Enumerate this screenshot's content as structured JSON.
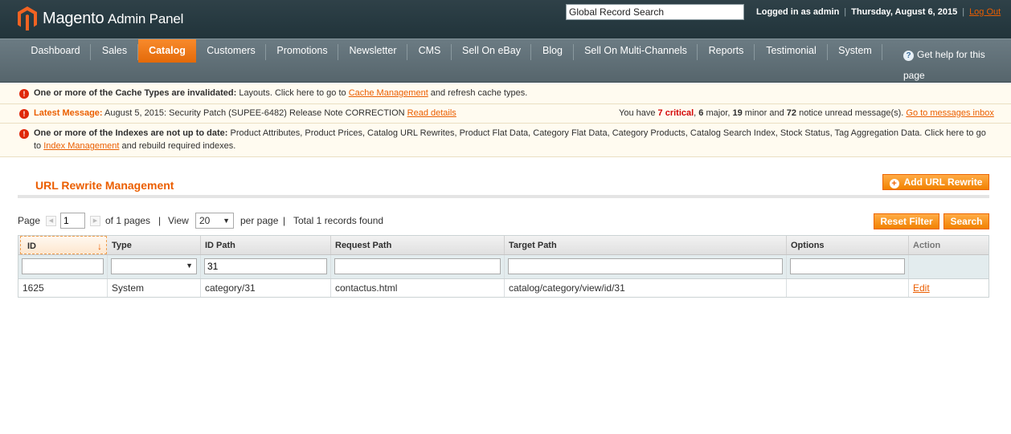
{
  "header": {
    "logo_main": "Magento",
    "logo_sub": "Admin Panel",
    "global_search_placeholder": "Global Record Search",
    "logged_in": "Logged in as admin",
    "date": "Thursday, August 6, 2015",
    "logout": "Log Out"
  },
  "nav": {
    "items": [
      "Dashboard",
      "Sales",
      "Catalog",
      "Customers",
      "Promotions",
      "Newsletter",
      "CMS",
      "Sell On eBay",
      "Blog",
      "Sell On Multi-Channels",
      "Reports",
      "Testimonial",
      "System"
    ],
    "active": "Catalog",
    "help": "Get help for this page"
  },
  "messages": {
    "cache": {
      "bold": "One or more of the Cache Types are invalidated:",
      "text1": " Layouts. Click here to go to ",
      "link": "Cache Management",
      "text2": " and refresh cache types."
    },
    "latest": {
      "label": "Latest Message:",
      "text": " August 5, 2015: Security Patch (SUPEE-6482) Release Note CORRECTION ",
      "link": "Read details",
      "summary_prefix": "You have ",
      "critical": "7 critical",
      "major_sep": ", ",
      "major": "6",
      "major_label": " major, ",
      "minor": "19",
      "minor_label": " minor and ",
      "notice": "72",
      "notice_label": " notice unread message(s). ",
      "inbox_link": "Go to messages inbox"
    },
    "index": {
      "bold": "One or more of the Indexes are not up to date:",
      "text1": " Product Attributes, Product Prices, Catalog URL Rewrites, Product Flat Data, Category Flat Data, Category Products, Catalog Search Index, Stock Status, Tag Aggregation Data. Click here to go",
      "text2": "to ",
      "link": "Index Management",
      "text3": " and rebuild required indexes."
    }
  },
  "page": {
    "title": "URL Rewrite Management",
    "add_button": "Add URL Rewrite",
    "reset_button": "Reset Filter",
    "search_button": "Search"
  },
  "pager": {
    "page_label": "Page",
    "page_value": "1",
    "of_pages": "of 1 pages",
    "sep": "|",
    "view_label": "View",
    "view_value": "20",
    "per_page": "per page",
    "total": "Total 1 records found"
  },
  "grid": {
    "columns": [
      "ID",
      "Type",
      "ID Path",
      "Request Path",
      "Target Path",
      "Options",
      "Action"
    ],
    "filters": {
      "id": "",
      "type": "",
      "id_path": "31",
      "request_path": "",
      "target_path": "",
      "options": ""
    },
    "rows": [
      {
        "id": "1625",
        "type": "System",
        "id_path": "category/31",
        "request_path": "contactus.html",
        "target_path": "catalog/category/view/id/31",
        "options": "",
        "action": "Edit"
      }
    ]
  },
  "colors": {
    "accent": "#eb5e00",
    "header_bg": "#2f4148",
    "nav_bg": "#5f6f76",
    "message_bg": "#fffbf0"
  }
}
